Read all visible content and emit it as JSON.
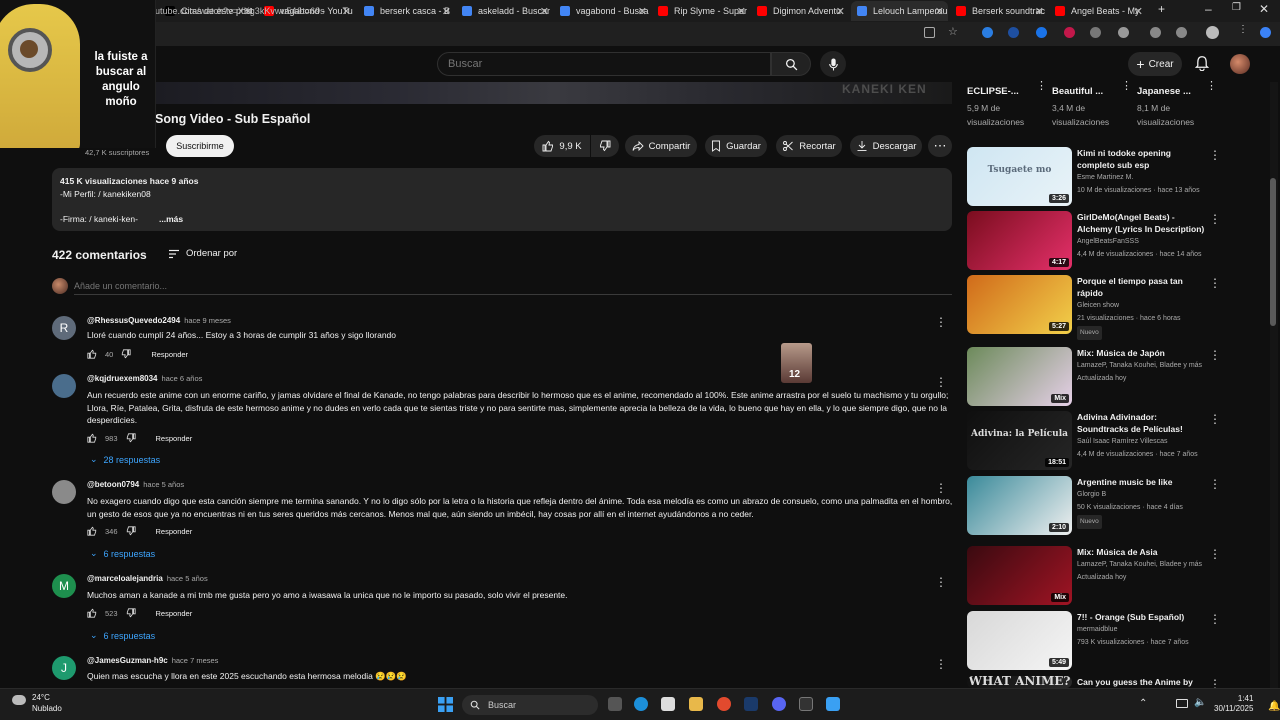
{
  "browser": {
    "tabs": [
      {
        "label": "Citas de este post",
        "color": "#000000"
      },
      {
        "label": "vagabond - YouTu",
        "color": "#ff0000"
      },
      {
        "label": "berserk casca - B",
        "color": "#4285f4"
      },
      {
        "label": "askeladd - Buscar",
        "color": "#4285f4"
      },
      {
        "label": "vagabond - Busca",
        "color": "#4285f4"
      },
      {
        "label": "Rip Slyme - Super",
        "color": "#ff0000"
      },
      {
        "label": "Digimon Adventu",
        "color": "#ff0000"
      },
      {
        "label": "Lelouch Lamperou",
        "color": "#4285f4"
      },
      {
        "label": "Berserk soundtrac",
        "color": "#ff0000"
      },
      {
        "label": "Angel Beats - My",
        "color": "#ff0000"
      }
    ],
    "url": "utube.com/watch?v=XKg3kKvwu54&t=69s"
  },
  "header": {
    "search_placeholder": "Buscar",
    "create_label": "Crear"
  },
  "meme": {
    "text": "la fuiste a buscar al angulo moño"
  },
  "video": {
    "watermark": "KANEKI KEN",
    "title": "Song Video - Sub Español",
    "subscribers": "42,7 K suscriptores",
    "subscribe_label": "Suscribirme",
    "likes": "9,9 K",
    "share_label": "Compartir",
    "save_label": "Guardar",
    "clip_label": "Recortar",
    "download_label": "Descargar"
  },
  "description": {
    "stats": "415 K visualizaciones  hace 9 años",
    "profile_line": "-Mi Perfil:  / kanekiken08",
    "sign_line": "-Firma:  / kaneki-ken-",
    "more_label": "...más"
  },
  "comments": {
    "count_label": "422 comentarios",
    "sort_label": "Ordenar por",
    "add_placeholder": "Añade un comentario...",
    "reply_label": "Responder",
    "items": [
      {
        "author": "@RhessusQuevedo2494",
        "age": "hace 9 meses",
        "initial": "R",
        "avatar_color": "#5f6b7a",
        "text": "Lloré cuando cumplí 24 años... Estoy a 3 horas de cumplir 31 años y sigo llorando",
        "likes": "40",
        "replies": ""
      },
      {
        "author": "@kqjdruexem8034",
        "age": "hace 6 años",
        "initial": "",
        "avatar_color": "#4a6d8c",
        "text": "Aun recuerdo este anime con un enorme cariño, y jamas olvidare el final de Kanade, no tengo palabras para describir lo hermoso que es el anime, recomendado al 100%. Este anime arrastra por el suelo tu machismo y tu orgullo; Llora, Ríe, Patalea, Grita, disfruta de este hermoso anime y no dudes en verlo cada que te sientas triste y no para sentirte mas, simplemente aprecia la belleza de la vida, lo bueno que hay en ella, y lo que siempre digo, que no la desperdicies.",
        "likes": "983",
        "replies": "28 respuestas"
      },
      {
        "author": "@betoon0794",
        "age": "hace 5 años",
        "initial": "",
        "avatar_color": "#8a8a8a",
        "text": "No exagero cuando digo que esta canción siempre me termina sanando. Y no lo digo sólo por la letra o la historia que refleja dentro del ánime. Toda esa melodía es como un abrazo de consuelo, como una palmadita en el hombro, un gesto de esos que ya no encuentras ni en tus seres queridos más cercanos. Menos mal que, aún siendo un imbécil, hay cosas por allí en el internet ayudándonos a no ceder.",
        "likes": "346",
        "replies": "6 respuestas"
      },
      {
        "author": "@marceloalejandria",
        "age": "hace 5 años",
        "initial": "M",
        "avatar_color": "#1e8f4e",
        "text": "Muchos aman a kanade a mi tmb me gusta pero yo amo a iwasawa la unica que no le importo su pasado, solo vivir el presente.",
        "likes": "523",
        "replies": "6 respuestas"
      },
      {
        "author": "@JamesGuzman-h9c",
        "age": "hace 7 meses",
        "initial": "J",
        "avatar_color": "#1e9a6e",
        "text": "Quien mas escucha y llora en este 2025 escuchando esta hermosa melodia 😢😢😢",
        "likes": "",
        "replies": ""
      }
    ],
    "sticker_number": "12"
  },
  "sidebar": {
    "top_cards": [
      {
        "title": "ECLIPSE-...",
        "views": "5,9 M de visualizaciones"
      },
      {
        "title": "Beautiful ...",
        "views": "3,4 M de visualizaciones"
      },
      {
        "title": "Japanese ...",
        "views": "8,1 M de visualizaciones"
      }
    ],
    "related": [
      {
        "title": "Kimi ni todoke opening completo sub esp",
        "channel": "Esme Martinez M.",
        "meta": "10 M de visualizaciones · hace 13 años",
        "duration": "3:26",
        "badge": "",
        "thumb_text": "Tsugaete mo",
        "colors": [
          "#cfe6f2",
          "#e9f3f8"
        ]
      },
      {
        "title": "GirlDeMo(Angel Beats) - Alchemy (Lyrics In Description)",
        "channel": "AngelBeatsFanSSS",
        "meta": "4,4 M de visualizaciones · hace 14 años",
        "duration": "4:17",
        "badge": "",
        "thumb_text": "",
        "colors": [
          "#7a0d1e",
          "#e5306a"
        ]
      },
      {
        "title": "Porque el tiempo pasa tan rápido",
        "channel": "Gleicen show",
        "meta": "21 visualizaciones · hace 6 horas",
        "duration": "5:27",
        "badge": "Nuevo",
        "thumb_text": "",
        "colors": [
          "#d06a1a",
          "#f2d04a"
        ]
      },
      {
        "title": "Mix: Música de Japón",
        "channel": "LamazeP, Tanaka Kouhei, Bladee y más",
        "meta": "Actualizada hoy",
        "duration": "Mix",
        "badge": "",
        "thumb_text": "",
        "colors": [
          "#6c8a5a",
          "#e6d0e8"
        ]
      },
      {
        "title": "Adivina Adivinador: Soundtracks de Películas!",
        "channel": "Saúl Isaac Ramírez Villescas",
        "meta": "4,4 M de visualizaciones · hace 7 años",
        "duration": "18:51",
        "badge": "",
        "thumb_text": "Adivina: la Película",
        "colors": [
          "#0f0f0f",
          "#262626"
        ]
      },
      {
        "title": "Argentine music be like",
        "channel": "Glorgio B",
        "meta": "50 K visualizaciones · hace 4 días",
        "duration": "2:10",
        "badge": "Nuevo",
        "thumb_text": "",
        "colors": [
          "#3a8a9a",
          "#f0f0f0"
        ]
      },
      {
        "title": "Mix: Música de Asia",
        "channel": "LamazeP, Tanaka Kouhei, Bladee y más",
        "meta": "Actualizada hoy",
        "duration": "Mix",
        "badge": "",
        "thumb_text": "",
        "colors": [
          "#3a0a10",
          "#a01424"
        ]
      },
      {
        "title": "7!! - Orange (Sub Español)",
        "channel": "mermaidblue",
        "meta": "793 K visualizaciones · hace 7 años",
        "duration": "5:49",
        "badge": "",
        "thumb_text": "",
        "colors": [
          "#d8d8d8",
          "#f5f5f5"
        ]
      },
      {
        "title": "Can you guess the Anime by the",
        "channel": "",
        "meta": "",
        "duration": "",
        "badge": "",
        "thumb_text": "WHAT ANIME?",
        "colors": [
          "#101010",
          "#2a2a2a"
        ]
      }
    ]
  },
  "taskbar": {
    "temperature": "24°C",
    "weather": "Nublado",
    "search_label": "Buscar",
    "time": "1:41",
    "date": "30/11/2025"
  }
}
